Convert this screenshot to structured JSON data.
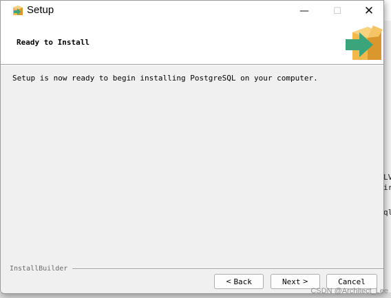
{
  "window": {
    "title": "Setup",
    "controls": {
      "minimize_glyph": "—",
      "maximize_glyph": "☐",
      "close_glyph": "✕",
      "minimize_icon": "minimize-icon",
      "maximize_icon": "maximize-icon",
      "close_icon": "close-icon"
    },
    "app_icon": "setup-box-arrow-icon"
  },
  "header": {
    "title": "Ready to Install",
    "logo_icon": "install-box-arrow-icon",
    "colors": {
      "box": "#f2b94a",
      "box_shade": "#d9972e",
      "arrow": "#3aa57a"
    }
  },
  "main": {
    "message": "Setup is now ready to begin installing PostgreSQL on your computer."
  },
  "footer": {
    "brand": "InstallBuilder",
    "buttons": {
      "back": {
        "chevron": "<",
        "label": "Back"
      },
      "next": {
        "label": "Next",
        "chevron": ">"
      },
      "cancel": {
        "label": "Cancel"
      }
    }
  },
  "background_window": {
    "fragments": [
      "LV",
      "ir",
      "ql"
    ]
  },
  "watermark": "CSDN @Architect_Lee"
}
